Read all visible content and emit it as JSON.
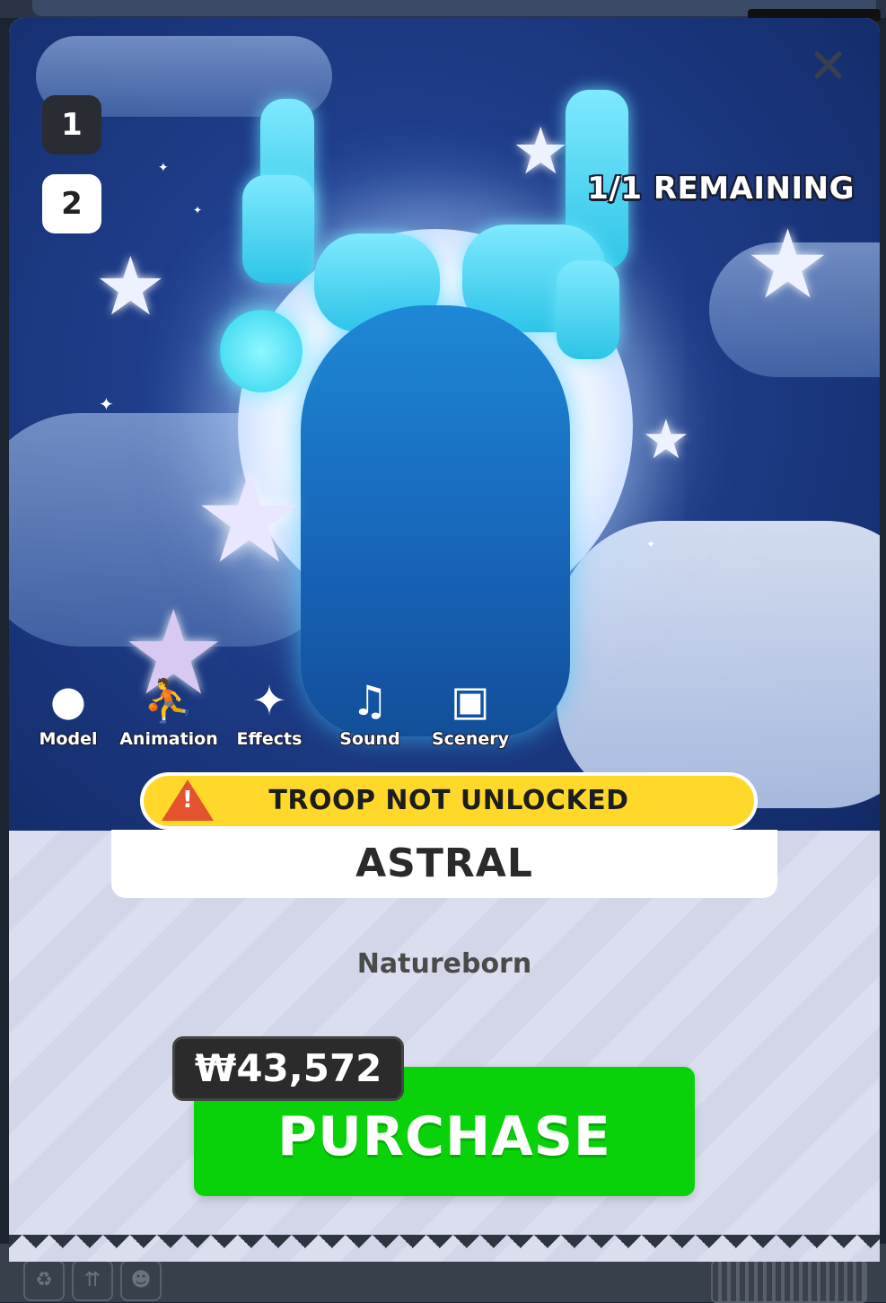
{
  "header": {
    "close_icon": "close-icon",
    "page_badges": [
      "1",
      "2"
    ],
    "remaining": "1/1 REMAINING"
  },
  "tools": [
    {
      "label": "Model",
      "icon": "person-icon"
    },
    {
      "label": "Animation",
      "icon": "running-person-icon"
    },
    {
      "label": "Effects",
      "icon": "sparkles-icon"
    },
    {
      "label": "Sound",
      "icon": "music-note-icon"
    },
    {
      "label": "Scenery",
      "icon": "picture-icon"
    }
  ],
  "warning": {
    "text": "TROOP NOT UNLOCKED",
    "icon": "warning-triangle-icon",
    "color": "#ffd82a"
  },
  "item": {
    "name": "ASTRAL",
    "category": "Natureborn"
  },
  "purchase": {
    "price": "₩43,572",
    "label": "PURCHASE",
    "color": "#0ad20a"
  }
}
